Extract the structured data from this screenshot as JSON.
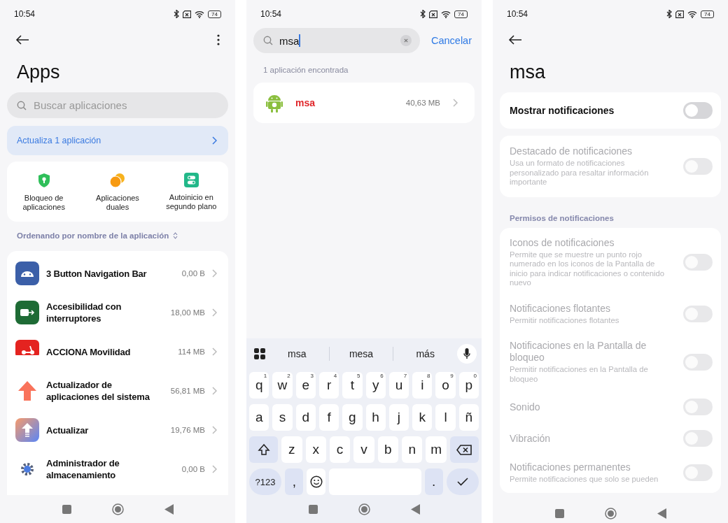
{
  "apps_screen": {
    "status_bar": {
      "time": "10:54",
      "battery": "74"
    },
    "title": "Apps",
    "search": {
      "placeholder": "Buscar aplicaciones"
    },
    "update_banner": "Actualiza 1 aplicación",
    "shortcuts": [
      {
        "label": "Bloqueo de aplicaciones"
      },
      {
        "label": "Aplicaciones duales"
      },
      {
        "label": "Autoinicio en segundo plano"
      }
    ],
    "sort_label": "Ordenando por nombre de la aplicación",
    "apps": [
      {
        "name": "3 Button Navigation Bar",
        "size": "0,00 B"
      },
      {
        "name": "Accesibilidad con interruptores",
        "size": "18,00 MB"
      },
      {
        "name": "ACCIONA Movilidad",
        "size": "114 MB"
      },
      {
        "name": "Actualizador de aplicaciones del sistema",
        "size": "56,81 MB"
      },
      {
        "name": "Actualizar",
        "size": "19,76 MB"
      },
      {
        "name": "Administrador de almacenamiento",
        "size": "0,00 B"
      }
    ]
  },
  "search_screen": {
    "status_bar": {
      "time": "10:54",
      "battery": "74"
    },
    "search": {
      "value": "msa"
    },
    "cancel": "Cancelar",
    "result_count": "1 aplicación encontrada",
    "results": [
      {
        "name": "msa",
        "size": "40,63 MB"
      }
    ],
    "keyboard": {
      "suggestions": [
        "msa",
        "mesa",
        "más"
      ],
      "rows": [
        [
          {
            "kind": "letter",
            "label": "q",
            "hint": "1"
          },
          {
            "kind": "letter",
            "label": "w",
            "hint": "2"
          },
          {
            "kind": "letter",
            "label": "e",
            "hint": "3"
          },
          {
            "kind": "letter",
            "label": "r",
            "hint": "4"
          },
          {
            "kind": "letter",
            "label": "t",
            "hint": "5"
          },
          {
            "kind": "letter",
            "label": "y",
            "hint": "6"
          },
          {
            "kind": "letter",
            "label": "u",
            "hint": "7"
          },
          {
            "kind": "letter",
            "label": "i",
            "hint": "8"
          },
          {
            "kind": "letter",
            "label": "o",
            "hint": "9"
          },
          {
            "kind": "letter",
            "label": "p",
            "hint": "0"
          }
        ],
        [
          {
            "kind": "letter",
            "label": "a"
          },
          {
            "kind": "letter",
            "label": "s"
          },
          {
            "kind": "letter",
            "label": "d"
          },
          {
            "kind": "letter",
            "label": "f"
          },
          {
            "kind": "letter",
            "label": "g"
          },
          {
            "kind": "letter",
            "label": "h"
          },
          {
            "kind": "letter",
            "label": "j"
          },
          {
            "kind": "letter",
            "label": "k"
          },
          {
            "kind": "letter",
            "label": "l"
          },
          {
            "kind": "letter",
            "label": "ñ"
          }
        ],
        [
          {
            "kind": "shift"
          },
          {
            "kind": "letter",
            "label": "z"
          },
          {
            "kind": "letter",
            "label": "x"
          },
          {
            "kind": "letter",
            "label": "c"
          },
          {
            "kind": "letter",
            "label": "v"
          },
          {
            "kind": "letter",
            "label": "b"
          },
          {
            "kind": "letter",
            "label": "n"
          },
          {
            "kind": "letter",
            "label": "m"
          },
          {
            "kind": "backspace"
          }
        ],
        [
          {
            "kind": "symbols",
            "label": "?123"
          },
          {
            "kind": "punct",
            "label": ","
          },
          {
            "kind": "emoji"
          },
          {
            "kind": "space"
          },
          {
            "kind": "punct",
            "label": "."
          },
          {
            "kind": "enter"
          }
        ]
      ]
    }
  },
  "notifications_screen": {
    "status_bar": {
      "time": "10:54",
      "battery": "74"
    },
    "title": "msa",
    "groups": [
      {
        "items": [
          {
            "title": "Mostrar notificaciones",
            "on": false,
            "disabled": false
          }
        ]
      },
      {
        "items": [
          {
            "title": "Destacado de notificaciones",
            "description": "Usa un formato de notificaciones personalizado para resaltar información importante",
            "on": false,
            "disabled": true
          }
        ]
      },
      {
        "header": "Permisos de notificaciones",
        "items": [
          {
            "title": "Iconos de notificaciones",
            "description": "Permite que se muestre un punto rojo numerado en los iconos de la Pantalla de inicio para indicar notificaciones o contenido nuevo",
            "on": false,
            "disabled": true
          },
          {
            "title": "Notificaciones flotantes",
            "description": "Permitir notificaciones flotantes",
            "on": false,
            "disabled": true
          },
          {
            "title": "Notificaciones en la Pantalla de bloqueo",
            "description": "Permitir notificaciones en la Pantalla de bloqueo",
            "on": false,
            "disabled": true
          },
          {
            "title": "Sonido",
            "on": false,
            "disabled": true
          },
          {
            "title": "Vibración",
            "on": false,
            "disabled": true
          },
          {
            "title": "Notificaciones permanentes",
            "description": "Permite notificaciones que solo se pueden",
            "on": false,
            "disabled": true
          }
        ]
      }
    ]
  }
}
